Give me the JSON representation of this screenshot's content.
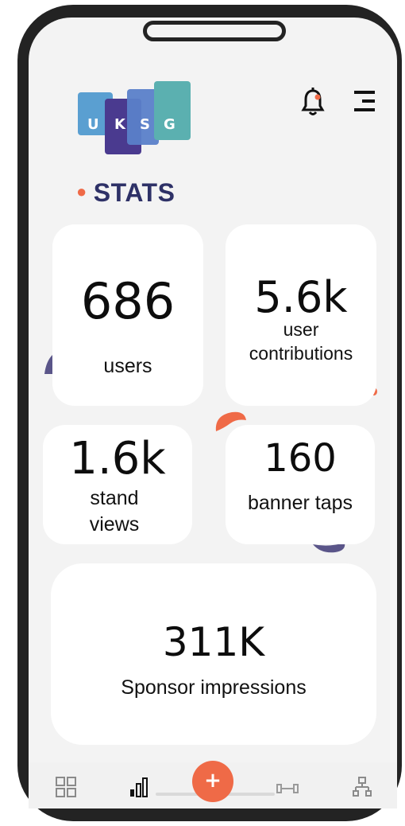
{
  "logo": {
    "letters": [
      "U",
      "K",
      "S",
      "G"
    ],
    "alt": "UKSG"
  },
  "header": {
    "notification_icon": "bell-icon",
    "menu_icon": "menu-icon"
  },
  "section": {
    "title": "STATS"
  },
  "stats": {
    "users": {
      "value": "686",
      "label": "users"
    },
    "contributions": {
      "value": "5.6k",
      "label_line1": "user",
      "label_line2": "contributions"
    },
    "stand_views": {
      "value": "1.6k",
      "label_line1": "stand",
      "label_line2": "views"
    },
    "banner_taps": {
      "value": "160",
      "label": "banner taps"
    },
    "sponsor": {
      "value": "311K",
      "label": "Sponsor impressions"
    }
  },
  "nav": {
    "items": [
      "dashboard-icon",
      "bar-chart-icon",
      "add-icon",
      "dumbbell-icon",
      "sitemap-icon"
    ],
    "fab_label": "+"
  },
  "colors": {
    "accent": "#ef6a47",
    "title": "#2e3167",
    "logo_blue": "#5a9fd1",
    "logo_purple": "#4a3a8f",
    "logo_teal": "#5bb0b0"
  }
}
